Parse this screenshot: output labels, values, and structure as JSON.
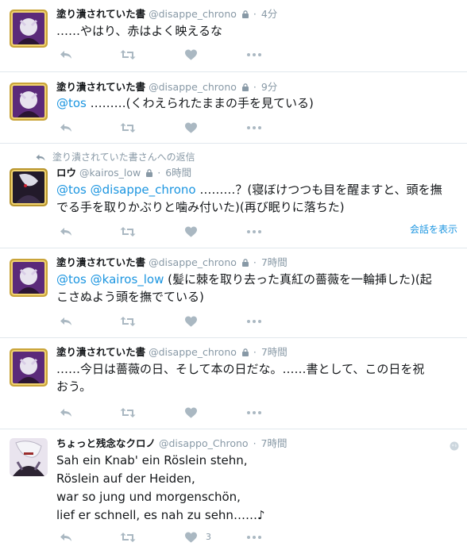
{
  "tweets": [
    {
      "name": "塗り潰されていた書",
      "screen_name": "@disappe_chrono",
      "protected": true,
      "time": "4分",
      "text": "……やはり、赤はよく映えるな",
      "avatar": "purple-gold-frame-avatar"
    },
    {
      "name": "塗り潰されていた書",
      "screen_name": "@disappe_chrono",
      "protected": true,
      "time": "9分",
      "mention": "@tos",
      "text": " ………(くわえられたままの手を見ている)",
      "avatar": "purple-gold-frame-avatar"
    },
    {
      "context": "塗り潰されていた書さんへの返信",
      "name": "ロウ",
      "screen_name": "@kairos_low",
      "protected": true,
      "time": "6時間",
      "mentions": [
        "@tos",
        "@disappe_chrono"
      ],
      "text_line1": " ………？(寝ぼけつつも目を醒ますと、頭を撫",
      "text_line2": "でる手を取りかぶりと噛み付いた)(再び眠りに落ちた)",
      "conversation_link": "会話を表示",
      "avatar": "dark-gold-frame-avatar"
    },
    {
      "name": "塗り潰されていた書",
      "screen_name": "@disappe_chrono",
      "protected": true,
      "time": "7時間",
      "mentions": [
        "@tos",
        "@kairos_low"
      ],
      "text_line1": " (髪に棘を取り去った真紅の薔薇を一輪挿した)(起",
      "text_line2": "こさぬよう頭を撫でている)",
      "avatar": "purple-gold-frame-avatar"
    },
    {
      "name": "塗り潰されていた書",
      "screen_name": "@disappe_chrono",
      "protected": true,
      "time": "7時間",
      "text_line1": "……今日は薔薇の日、そして本の日だな。……書として、この日を祝",
      "text_line2": "おう。",
      "avatar": "purple-gold-frame-avatar"
    },
    {
      "name": "ちょっと残念なクロノ",
      "screen_name": "@disappo_Chrono",
      "protected": false,
      "time": "7時間",
      "lines": [
        "Sah ein Knab' ein Röslein stehn,",
        "Röslein auf der Heiden,",
        "war so jung und morgenschön,",
        "lief er schnell, es nah zu sehn……♪"
      ],
      "like_count": "3",
      "avatar": "white-hair-character-avatar"
    }
  ],
  "colors": {
    "link": "#1b95e0",
    "secondary_text": "#8899a6",
    "action_icon": "#aab8c2",
    "divider": "#e1e8ed"
  },
  "icons": [
    "reply-icon",
    "retweet-icon",
    "like-icon",
    "more-icon",
    "lock-icon",
    "globe-icon"
  ]
}
